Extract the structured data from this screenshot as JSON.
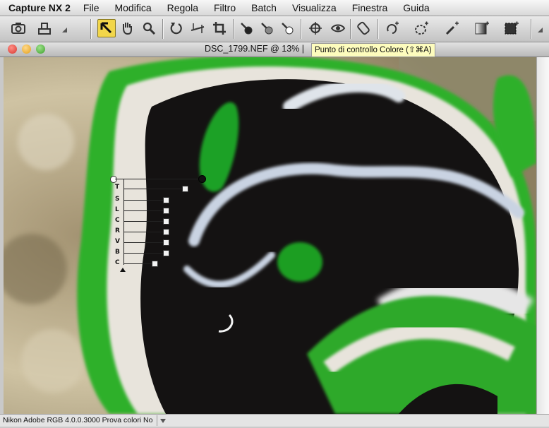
{
  "menu": {
    "app_name": "Capture NX 2",
    "items": [
      "File",
      "Modifica",
      "Regola",
      "Filtro",
      "Batch",
      "Visualizza",
      "Finestra",
      "Guida"
    ]
  },
  "toolbar": {
    "icons": [
      "camera-icon",
      "print-icon",
      "arrow-select-icon",
      "hand-icon",
      "zoom-icon",
      "rotate-icon",
      "straighten-icon",
      "crop-icon",
      "black-point-icon",
      "neutral-point-icon",
      "white-point-icon",
      "color-control-point-icon",
      "red-eye-icon",
      "auto-retouch-icon",
      "lasso-icon",
      "selection-brush-icon",
      "gradient-icon",
      "fill-icon"
    ]
  },
  "window": {
    "title": "DSC_1799.NEF @ 13% |",
    "tooltip": "Punto di controllo Colore (⇧⌘A)"
  },
  "control_point": {
    "labels": [
      "T",
      "S",
      "L",
      "C",
      "R",
      "V",
      "B",
      "C"
    ]
  },
  "status": {
    "text": "Nikon Adobe RGB 4.0.0.3000  Prova colori No"
  },
  "colors": {
    "highlight": "#f2d64a",
    "tooltip_bg": "#fdfcbd",
    "close": "#e2463f",
    "minimize": "#f0b52b",
    "zoom": "#4fb43a"
  }
}
